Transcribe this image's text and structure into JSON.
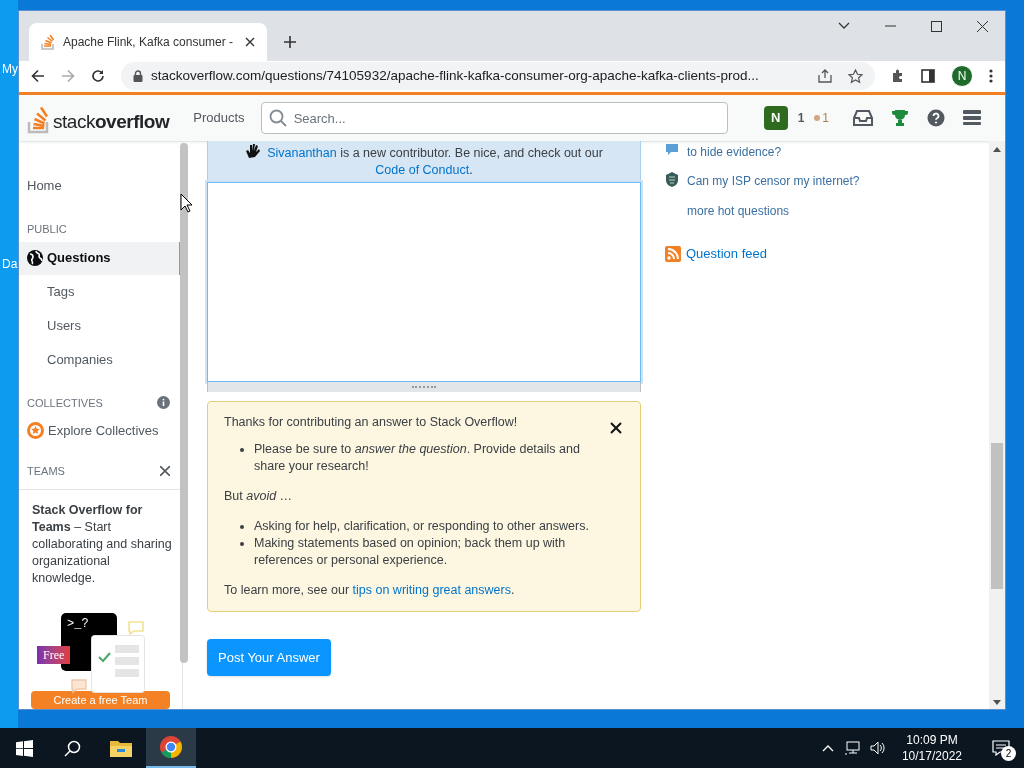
{
  "desktop_icons": [
    "My",
    "Da"
  ],
  "browser": {
    "tab_title": "Apache Flink, Kafka consumer -",
    "url": "stackoverflow.com/questions/74105932/apache-flink-kafka-consumer-org-apache-kafka-clients-prod...",
    "profile_initial": "N"
  },
  "topbar": {
    "logo_light": "stack",
    "logo_bold": "overflow",
    "products": "Products",
    "search_placeholder": "Search...",
    "avatar_initial": "N",
    "reputation": "1",
    "bronze_badges": "1"
  },
  "sidebar": {
    "home": {
      "label": "Home",
      "selected": false
    },
    "public_heading": "PUBLIC",
    "public_items": [
      {
        "label": "Questions",
        "selected": true
      },
      {
        "label": "Tags",
        "selected": false
      },
      {
        "label": "Users",
        "selected": false
      },
      {
        "label": "Companies",
        "selected": false
      }
    ],
    "collectives_heading": "COLLECTIVES",
    "explore": "Explore Collectives",
    "teams_heading": "TEAMS",
    "teams_promo": "**Stack Overflow for Teams** – Start collaborating and sharing organizational knowledge.",
    "illustration_prompt": ">_?",
    "free_badge": "Free",
    "create_button": "Create a free Team"
  },
  "main": {
    "notice": {
      "user": "Sivananthan",
      "text": " is a new contributor. Be nice, and check out our ",
      "link": "Code of Conduct",
      "end": "."
    },
    "tips": {
      "title": "Thanks for contributing an answer to Stack Overflow!",
      "do": [
        "Please be sure to *answer the question*. Provide details and share your research!"
      ],
      "avoid_intro": "But *avoid* …",
      "avoid": [
        "Asking for help, clarification, or responding to other answers.",
        "Making statements based on opinion; back them up with references or personal experience."
      ],
      "footer": "To learn more, see our ",
      "footer_link": "tips on writing great answers",
      "footer_end": "."
    },
    "post_button": "Post Your Answer"
  },
  "right": {
    "hot_questions": [
      {
        "kind": "chat",
        "text": "to hide evidence?"
      },
      {
        "kind": "shield",
        "text": "Can my ISP censor my internet?"
      }
    ],
    "more": "more hot questions",
    "feed": "Question feed"
  },
  "taskbar": {
    "time": "10:09 PM",
    "date": "10/17/2022",
    "notifications": "2"
  }
}
